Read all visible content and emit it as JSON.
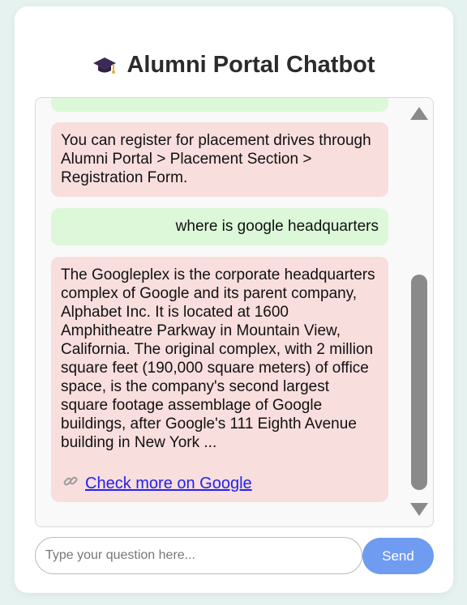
{
  "header": {
    "title": "Alumni Portal Chatbot",
    "icon": "graduation-cap-icon"
  },
  "messages": [
    {
      "role": "user",
      "text": ""
    },
    {
      "role": "bot",
      "text": "You can register for placement drives through Alumni Portal > Placement Section > Registration Form."
    },
    {
      "role": "user",
      "text": "where is google headquarters"
    },
    {
      "role": "bot",
      "text": "The Googleplex is the corporate headquarters complex of Google and its parent company, Alphabet Inc. It is located at 1600 Amphitheatre Parkway in Mountain View, California. The original complex, with 2 million square feet (190,000 square meters) of office space, is the company's second largest square footage assemblage of Google buildings, after Google's 111 Eighth Avenue building in New York ...",
      "link_label": "Check more on Google",
      "link_icon": "link-icon"
    }
  ],
  "composer": {
    "placeholder": "Type your question here...",
    "value": "",
    "send_label": "Send"
  },
  "colors": {
    "user_bubble": "#dcf8d9",
    "bot_bubble": "#f8dedd",
    "send_button": "#6f9bf1",
    "link": "#2222ee"
  }
}
